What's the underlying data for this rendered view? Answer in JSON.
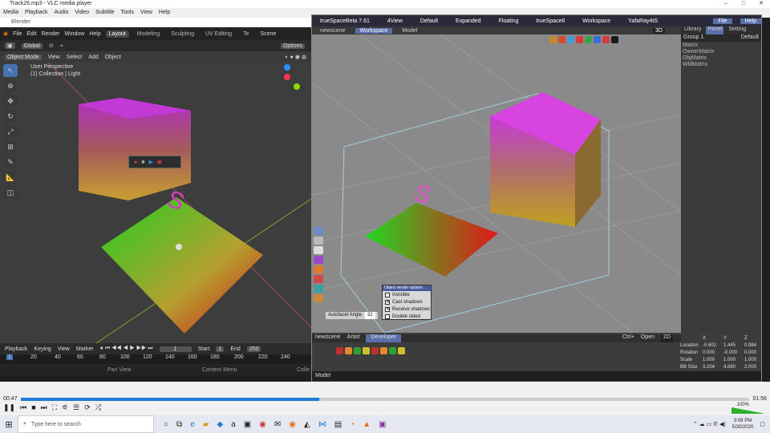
{
  "vlc": {
    "title": "Track26.mp3 - VLC media player",
    "menu": [
      "Media",
      "Playback",
      "Audio",
      "Video",
      "Subtitle",
      "Tools",
      "View",
      "Help"
    ],
    "time_elapsed": "00:47",
    "time_total": "01:56",
    "progress": 0.41,
    "volume": "100%"
  },
  "blender": {
    "title": "Blender",
    "menus": [
      "File",
      "Edit",
      "Render",
      "Window",
      "Help"
    ],
    "workspaces": [
      "Layout",
      "Modeling",
      "Sculpting",
      "UV Editing",
      "Te"
    ],
    "scene": "Scene",
    "orientation": "Global",
    "options": "Options",
    "mode": "Object Mode",
    "header_menus": [
      "View",
      "Select",
      "Add",
      "Object"
    ],
    "view_name": "User Perspective",
    "collection": "(1) Collection | Light",
    "timeline": {
      "menus": [
        "Playback",
        "Keying",
        "View",
        "Marker"
      ],
      "current_frame": "1",
      "start_label": "Start",
      "start": "1",
      "end_label": "End",
      "end": "250",
      "ruler": [
        "1",
        "20",
        "40",
        "60",
        "80",
        "100",
        "120",
        "140",
        "160",
        "180",
        "200",
        "220",
        "240"
      ]
    },
    "status": {
      "pan": "Pan View",
      "context": "Context Menu",
      "col": "Colle"
    }
  },
  "truespace": {
    "title": "trueSpaceBeta 7.61",
    "title_items": [
      "4View",
      "Default",
      "Expanded",
      "Floating",
      "trueSpace6",
      "Workspace",
      "YafaRay4tS"
    ],
    "file": "File",
    "help": "Help",
    "tabs": [
      "newscene",
      "Workspace",
      "Model"
    ],
    "view_label": "3D",
    "right_tabs": [
      "Library",
      "Panel",
      "Setting"
    ],
    "group": "Group 1",
    "group_value": "Default",
    "right_list": [
      "Matrix",
      "OwnerMatrix",
      "ObjMatrix",
      "WldMatrix"
    ],
    "render_options": {
      "title": "Object render options",
      "autofacet": "Autofacet Angle",
      "angle": "32",
      "items": [
        {
          "label": "Invisible",
          "checked": false
        },
        {
          "label": "Cast shadows",
          "checked": true
        },
        {
          "label": "Receive shadows",
          "checked": true
        },
        {
          "label": "Double sided",
          "checked": false
        }
      ]
    },
    "bottom_tabs": [
      "newscene",
      "Artist",
      "Developer"
    ],
    "ctrl_label": "Ctrl+",
    "open_label": "Open",
    "view2d": "2D",
    "status": "Model",
    "properties": {
      "headers": [
        "X",
        "Y",
        "Z"
      ],
      "rows": [
        {
          "name": "Location",
          "x": "-0.602",
          "y": "1.445",
          "z": "0.984"
        },
        {
          "name": "Rotation",
          "x": "0.000",
          "y": "-0.000",
          "z": "0.000"
        },
        {
          "name": "Scale",
          "x": "1.000",
          "y": "1.000",
          "z": "1.000"
        },
        {
          "name": "BB Size",
          "x": "3.204",
          "y": "4.890",
          "z": "2.000"
        }
      ]
    }
  },
  "taskbar": {
    "search": "Type here to search",
    "time": "3:09 PM",
    "date": "5/30/2020"
  }
}
